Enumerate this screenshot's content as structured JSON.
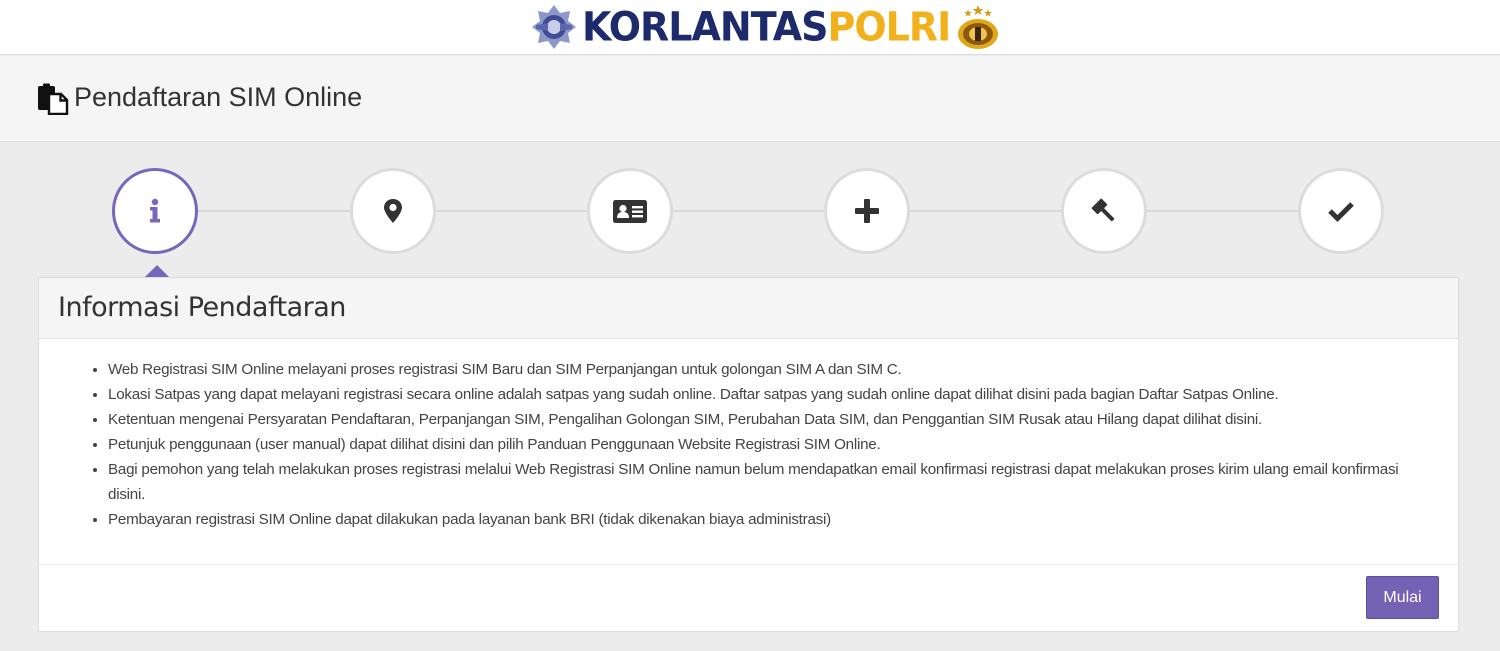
{
  "brand": {
    "part1": "KORLANTAS",
    "part2": "POLRI",
    "colors": {
      "primary": "#1d2a6b",
      "accent": "#f2b11a"
    },
    "left_emblem_icon": "korlantas-emblem-icon",
    "right_emblem_icon": "polri-emblem-icon"
  },
  "page": {
    "title": "Pendaftaran SIM Online",
    "title_icon": "paste-document-icon"
  },
  "stepper": {
    "active_index": 0,
    "active_color": "#7766bb",
    "steps": [
      {
        "icon": "info-icon"
      },
      {
        "icon": "map-marker-icon"
      },
      {
        "icon": "id-card-icon"
      },
      {
        "icon": "plus-icon"
      },
      {
        "icon": "gavel-icon"
      },
      {
        "icon": "check-icon"
      }
    ]
  },
  "panel": {
    "heading": "Informasi Pendaftaran",
    "items": [
      "Web Registrasi SIM Online melayani proses registrasi SIM Baru dan SIM Perpanjangan untuk golongan SIM A dan SIM C.",
      "Lokasi Satpas yang dapat melayani registrasi secara online adalah satpas yang sudah online. Daftar satpas yang sudah online dapat dilihat disini pada bagian Daftar Satpas Online.",
      "Ketentuan mengenai Persyaratan Pendaftaran, Perpanjangan SIM, Pengalihan Golongan SIM, Perubahan Data SIM, dan Penggantian SIM Rusak atau Hilang dapat dilihat disini.",
      "Petunjuk penggunaan (user manual) dapat dilihat disini dan pilih Panduan Penggunaan Website Registrasi SIM Online.",
      "Bagi pemohon yang telah melakukan proses registrasi melalui Web Registrasi SIM Online namun belum mendapatkan email konfirmasi registrasi dapat melakukan proses kirim ulang email konfirmasi disini.",
      "Pembayaran registrasi SIM Online dapat dilakukan pada layanan bank BRI (tidak dikenakan biaya administrasi)"
    ],
    "button_label": "Mulai",
    "button_color": "#7462b5"
  }
}
